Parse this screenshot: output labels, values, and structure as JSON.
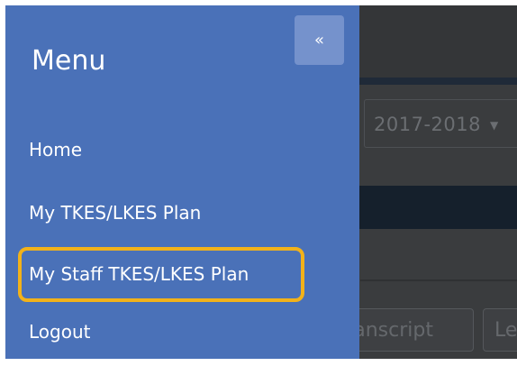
{
  "menu": {
    "title": "Menu",
    "collapse_label": "«",
    "items": [
      {
        "label": "Home"
      },
      {
        "label": "My TKES/LKES Plan"
      },
      {
        "label": "My Staff TKES/LKES Plan",
        "highlighted": true
      },
      {
        "label": "Logout"
      }
    ]
  },
  "background": {
    "year_select": {
      "value": "2017-2018",
      "caret": "▼"
    },
    "tabs": [
      {
        "label": "Transcript"
      },
      {
        "label": "Le"
      }
    ]
  },
  "colors": {
    "menu_bg": "#4a71b8",
    "collapse_button_bg": "#7592cc",
    "highlight_border": "#f2b21a",
    "overlay_bg": "#2e3033"
  }
}
